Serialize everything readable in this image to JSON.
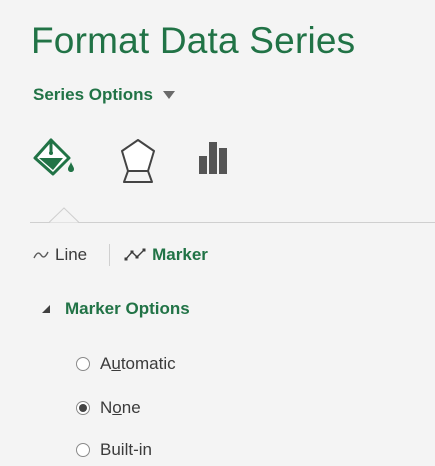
{
  "pane": {
    "title": "Format Data Series",
    "options_dropdown": {
      "label": "Series Options",
      "icon": "chevron-down-icon"
    }
  },
  "category_tabs": [
    {
      "name": "fill-line",
      "icon": "paint-bucket-icon",
      "selected": true
    },
    {
      "name": "effects",
      "icon": "pentagon-icon",
      "selected": false
    },
    {
      "name": "series-options",
      "icon": "bar-chart-icon",
      "selected": false
    }
  ],
  "subtabs": [
    {
      "label": "Line",
      "icon": "line-icon",
      "active": false
    },
    {
      "label": "Marker",
      "icon": "marker-line-icon",
      "active": true
    }
  ],
  "section": {
    "label": "Marker Options",
    "expanded": true,
    "options": [
      {
        "label": "Automatic",
        "accelerator": "u",
        "selected": false
      },
      {
        "label": "None",
        "accelerator": "o",
        "selected": true
      },
      {
        "label": "Built-in",
        "accelerator": "",
        "selected": false
      }
    ]
  },
  "colors": {
    "accent": "#217346",
    "pane_bg": "#f4f4f4",
    "text": "#3b3b3b"
  }
}
